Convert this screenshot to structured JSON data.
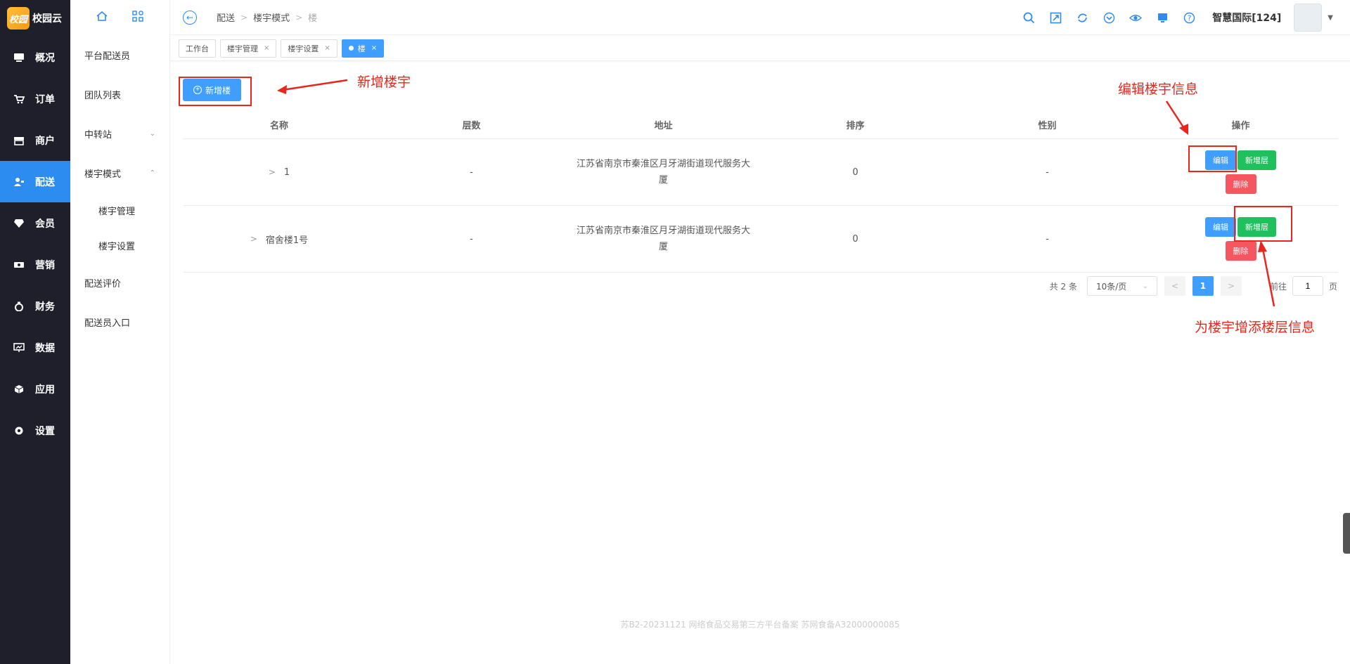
{
  "app": {
    "name": "校园云",
    "logo_text": "校园",
    "org": "智慧国际[124]"
  },
  "nav": [
    {
      "label": "概况",
      "icon": "monitor-icon"
    },
    {
      "label": "订单",
      "icon": "cart-icon"
    },
    {
      "label": "商户",
      "icon": "store-icon"
    },
    {
      "label": "配送",
      "icon": "user-delivery-icon",
      "active": true
    },
    {
      "label": "会员",
      "icon": "diamond-icon"
    },
    {
      "label": "营销",
      "icon": "ticket-icon"
    },
    {
      "label": "财务",
      "icon": "money-bag-icon"
    },
    {
      "label": "数据",
      "icon": "chart-screen-icon"
    },
    {
      "label": "应用",
      "icon": "cube-icon"
    },
    {
      "label": "设置",
      "icon": "gear-icon"
    }
  ],
  "subnav": {
    "items": [
      "平台配送员",
      "团队列表",
      "中转站",
      "楼宇模式"
    ],
    "children": [
      "楼宇管理",
      "楼宇设置"
    ],
    "after": [
      "配送评价",
      "配送员入口"
    ]
  },
  "breadcrumb": [
    "配送",
    "楼宇模式",
    "楼"
  ],
  "tabs": [
    {
      "label": "工作台",
      "closable": false
    },
    {
      "label": "楼宇管理",
      "closable": true
    },
    {
      "label": "楼宇设置",
      "closable": true
    },
    {
      "label": "楼",
      "closable": true,
      "active": true
    }
  ],
  "add_button": "新增楼",
  "table": {
    "headers": [
      "名称",
      "层数",
      "地址",
      "排序",
      "性别",
      "操作"
    ],
    "rows": [
      {
        "name": "1",
        "floors": "-",
        "address": "江苏省南京市秦淮区月牙湖街道现代服务大厦",
        "sort": "0",
        "gender": "-"
      },
      {
        "name": "宿舍楼1号",
        "floors": "-",
        "address": "江苏省南京市秦淮区月牙湖街道现代服务大厦",
        "sort": "0",
        "gender": "-"
      }
    ],
    "actions": {
      "edit": "编辑",
      "add_floor": "新增层",
      "delete": "删除"
    }
  },
  "pager": {
    "total": "共 2 条",
    "page_size": "10条/页",
    "current": "1",
    "goto_label": "前往",
    "goto_value": "1",
    "page_unit": "页"
  },
  "footer": "苏B2-20231121   网络食品交易第三方平台备案 苏网食备A32000000085",
  "annotations": {
    "add_building": "新增楼宇",
    "edit_info": "编辑楼宇信息",
    "add_floor_info": "为楼宇增添楼层信息"
  },
  "colors": {
    "accent": "#409eff",
    "sidebar_bg": "#1e1f2b",
    "success": "#21c05f",
    "danger": "#f5565f",
    "annotation": "#e8261c"
  }
}
